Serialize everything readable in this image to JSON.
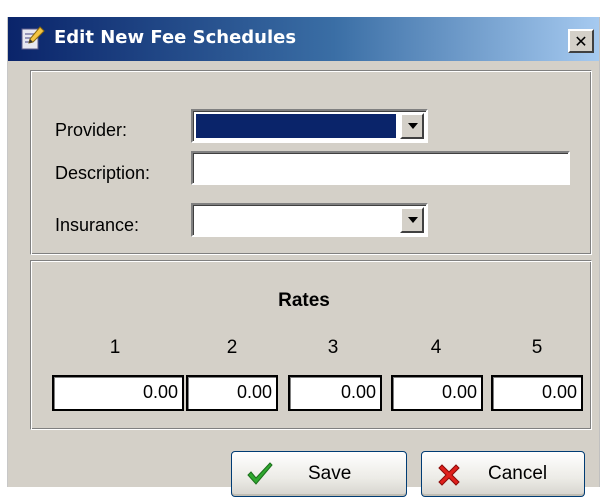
{
  "window": {
    "title": "Edit New Fee Schedules",
    "close_label": "✕"
  },
  "form": {
    "provider_label": "Provider:",
    "provider_value": "",
    "description_label": "Description:",
    "description_value": "",
    "insurance_label": "Insurance:",
    "insurance_value": ""
  },
  "rates": {
    "title": "Rates",
    "columns": [
      {
        "number": "1",
        "value": "0.00"
      },
      {
        "number": "2",
        "value": "0.00"
      },
      {
        "number": "3",
        "value": "0.00"
      },
      {
        "number": "4",
        "value": "0.00"
      },
      {
        "number": "5",
        "value": "0.00"
      }
    ]
  },
  "buttons": {
    "save_label": "Save",
    "cancel_label": "Cancel"
  },
  "colors": {
    "titlebar_start": "#0a246a",
    "titlebar_end": "#a6caf0",
    "selection": "#0a246a",
    "dialog_face": "#d4d0c8",
    "save_check": "#2fa82f",
    "cancel_x": "#e0201c"
  },
  "icons": {
    "title": "edit-form-icon",
    "close": "close-icon",
    "save": "checkmark-icon",
    "cancel": "red-x-icon"
  }
}
